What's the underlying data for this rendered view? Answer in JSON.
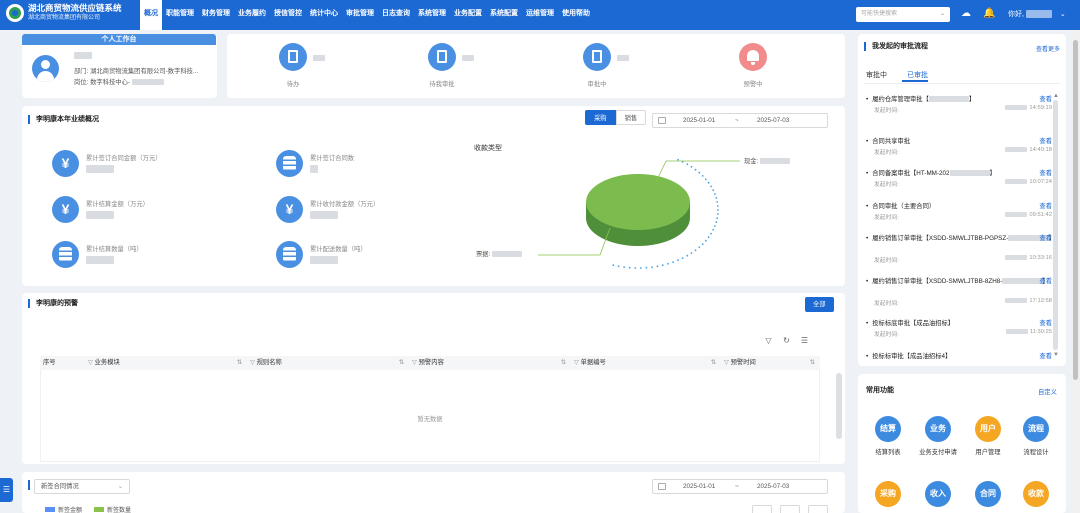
{
  "app": {
    "title": "湖北商贸物流供应链系统",
    "subtitle": "湖北商贸物流集团有限公司"
  },
  "nav": [
    {
      "label": "概况",
      "active": true
    },
    {
      "label": "职能管理"
    },
    {
      "label": "财务管理"
    },
    {
      "label": "业务履约"
    },
    {
      "label": "授信管控"
    },
    {
      "label": "统计中心"
    },
    {
      "label": "审批管理"
    },
    {
      "label": "日志查询"
    },
    {
      "label": "系统管理"
    },
    {
      "label": "业务配置"
    },
    {
      "label": "系统配置"
    },
    {
      "label": "运维管理"
    },
    {
      "label": "使用帮助"
    }
  ],
  "topbar": {
    "search_placeholder": "可能快捷搜索",
    "greeting": "你好,",
    "icons": [
      "cloud-download-icon",
      "bell-icon",
      "chevron-down-icon"
    ]
  },
  "personal": {
    "header": "个人工作台",
    "dept_label": "部门:",
    "dept_value": "湖北商贸物流集团有限公司-数字科技...",
    "post_label": "岗位:",
    "post_value": "数字科技中心-"
  },
  "stats": [
    {
      "label": "待办",
      "icon": "document-icon"
    },
    {
      "label": "待我审批",
      "icon": "document-icon"
    },
    {
      "label": "审批中",
      "icon": "document-icon"
    },
    {
      "label": "预警中",
      "icon": "bell-icon"
    }
  ],
  "performance": {
    "title": "李明康本年业绩概况",
    "tabs": [
      "采购",
      "销售"
    ],
    "active_tab": "采购",
    "date_start": "2025-01-01",
    "date_sep": "~",
    "date_end": "2025-07-03",
    "metrics": [
      {
        "label": "累计签订合同金额（万元）",
        "icon": "yen-icon"
      },
      {
        "label": "累计签订合同数",
        "icon": "database-icon"
      },
      {
        "label": "累计结算金额（万元）",
        "icon": "yen-icon"
      },
      {
        "label": "累计收付款金额（万元）",
        "icon": "yen-icon"
      },
      {
        "label": "累计结算数量（吨）",
        "icon": "database-icon"
      },
      {
        "label": "累计配送数量（吨）",
        "icon": "database-icon"
      }
    ],
    "pie_title": "收款类型",
    "pie_labels": [
      "现金:",
      "票据:"
    ]
  },
  "chart_data": {
    "type": "pie",
    "title": "收款类型",
    "categories": [
      "现金",
      "票据"
    ],
    "values": [
      0,
      100
    ],
    "colors": [
      "#8bc34a",
      "#6aa84f"
    ]
  },
  "warnings": {
    "title": "李明康的预警",
    "all_button": "全部",
    "toolbar_icons": [
      "filter-icon",
      "refresh-icon",
      "column-settings-icon"
    ],
    "columns": [
      "序号",
      "业务模块",
      "规则名称",
      "预警内容",
      "单据编号",
      "预警时间"
    ],
    "empty_text": "暂无数据"
  },
  "contract": {
    "select_value": "新签合同情况",
    "date_start": "2025-01-01",
    "date_sep": "~",
    "date_end": "2025-07-03",
    "legend": [
      {
        "label": "新签金额",
        "color": "#5b8ff9"
      },
      {
        "label": "新签数量",
        "color": "#8bc34a"
      }
    ]
  },
  "approvals": {
    "title": "我发起的审批流程",
    "more": "查看更多",
    "tabs": [
      "审批中",
      "已审批"
    ],
    "active_tab": "已审批",
    "view_label": "查看",
    "sent_label": "发起时间:",
    "items": [
      {
        "title": "履约仓库管理审批【",
        "title_tail": "】",
        "time": "14:59:19"
      },
      {
        "title": "合同共享审批",
        "time": "14:40:18"
      },
      {
        "title": "合同备案审批【HT-MM-202",
        "title_tail": "】",
        "time": "10:07:24"
      },
      {
        "title": "合同审批（主要合同）",
        "time": "09:51:42"
      },
      {
        "title": "履约销售订单审批【XSDD-SMWLJTBB-PGPSZ-",
        "title_tail": "】",
        "time": "10:33:16"
      },
      {
        "title": "履约销售订单审批【XSDD-SMWLJTBB-8ZH8-",
        "title_tail": "】",
        "time": "17:12:58"
      },
      {
        "title": "投标标底审批【成品油招标】",
        "time": "11:30:25"
      },
      {
        "title": "投标标审批【成品油招标4】",
        "time": ""
      }
    ]
  },
  "functions": {
    "title": "常用功能",
    "customize": "自定义",
    "items": [
      {
        "icon_text": "结算",
        "label": "结算列表",
        "color": "#3d8be0"
      },
      {
        "icon_text": "业务",
        "label": "业务支付申请",
        "color": "#3d8be0"
      },
      {
        "icon_text": "用户",
        "label": "用户管理",
        "color": "#f5a623"
      },
      {
        "icon_text": "流程",
        "label": "流程设计",
        "color": "#3d8be0"
      },
      {
        "icon_text": "采购",
        "label": "",
        "color": "#f5a623"
      },
      {
        "icon_text": "收入",
        "label": "",
        "color": "#3d8be0"
      },
      {
        "icon_text": "合同",
        "label": "",
        "color": "#3d8be0"
      },
      {
        "icon_text": "收款",
        "label": "",
        "color": "#f5a623"
      }
    ]
  }
}
